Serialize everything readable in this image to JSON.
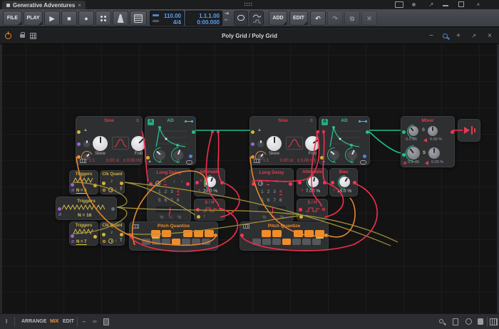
{
  "window": {
    "tab_title": "Generative Adventures",
    "title_center": "Poly Grid / Poly Grid"
  },
  "icons": {
    "close": "×",
    "minus": "−",
    "plus": "+",
    "play": "▶",
    "stop": "■",
    "rec": "●",
    "undo": "↶",
    "redo": "↷",
    "delete_x": "✕",
    "copy": "⧉",
    "pm": "±",
    "times": "×",
    "plusr": "+",
    "note8": "♪",
    "note4": "♩",
    "up": "↑",
    "half": "½",
    "phase": "ø",
    "solo": "S",
    "ibeam": "I",
    "expand": "↗"
  },
  "toolbar": {
    "file": "FILE",
    "play": "PLAY",
    "add": "ADD",
    "edit": "EDIT",
    "tempo": "110.00",
    "time_sig": "4/4",
    "position": "1.1.1.00",
    "time": "0:00.000"
  },
  "bottom": {
    "arrange": "ARRANGE",
    "mix": "MIX",
    "edit": "EDIT"
  },
  "modules": {
    "sine": {
      "title": "Sine",
      "skew": "Skew",
      "fold": "Fold",
      "ratio": "1:1",
      "st": "0.00 st",
      "hz": "± 0.00 Hz"
    },
    "ad": {
      "title": "AD",
      "badge": "A",
      "a": "A",
      "d": "D"
    },
    "longdelay": {
      "title": "Long Delay",
      "row1": [
        {
          "t": "1"
        },
        {
          "t": "2"
        },
        {
          "t": "3"
        },
        {
          "t": "4",
          "c": "sel"
        }
      ],
      "row2": [
        {
          "t": "5"
        },
        {
          "t": "6"
        },
        {
          "t": "7"
        },
        {
          "t": "8"
        }
      ],
      "fracs": [
        {
          "t": "½"
        },
        {
          "t": "½",
          "c": "sel"
        },
        {
          "t": "½"
        }
      ]
    },
    "attenuate_a": {
      "title": "Attenuate",
      "value": "20.0 %"
    },
    "attenuate_b": {
      "title": "Attenuate",
      "value": "7.00 %"
    },
    "bias": {
      "title": "Bias",
      "value": "18.0 %"
    },
    "sh": {
      "title": "S / H"
    },
    "clkquant": {
      "title": "Clk Quant",
      "t": "T"
    },
    "triggers16": {
      "title": "Triggers",
      "value": "N = 16"
    },
    "triggers5": {
      "title": "Triggers",
      "value": "N = 5"
    },
    "triggers7": {
      "title": "Triggers",
      "value": "N = 7"
    },
    "pq": {
      "title": "Pitch Quantize",
      "top_a": [
        {
          "c": "on ul"
        },
        {
          "c": "on"
        },
        {
          "c": "sp"
        },
        {
          "c": "on"
        },
        {
          "c": "on"
        },
        {
          "c": "on"
        }
      ],
      "top_b": [
        {
          "c": "on"
        },
        {
          "c": "on"
        },
        {
          "c": "sp"
        },
        {
          "c": "on"
        },
        {
          "c": "on"
        },
        {
          "c": "on ul"
        }
      ],
      "bottom": [
        {
          "c": ""
        },
        {
          "c": ""
        },
        {
          "c": ""
        },
        {
          "c": "on"
        },
        {
          "c": ""
        },
        {
          "c": ""
        },
        {
          "c": ""
        }
      ]
    },
    "mixer": {
      "title": "Mixer",
      "ch1": {
        "gain": "0.0 dB",
        "pan": "0.00 %",
        "solo": "S"
      },
      "ch2": {
        "gain": "0.0 dB",
        "pan": "0.00 %",
        "solo": "S"
      }
    }
  }
}
